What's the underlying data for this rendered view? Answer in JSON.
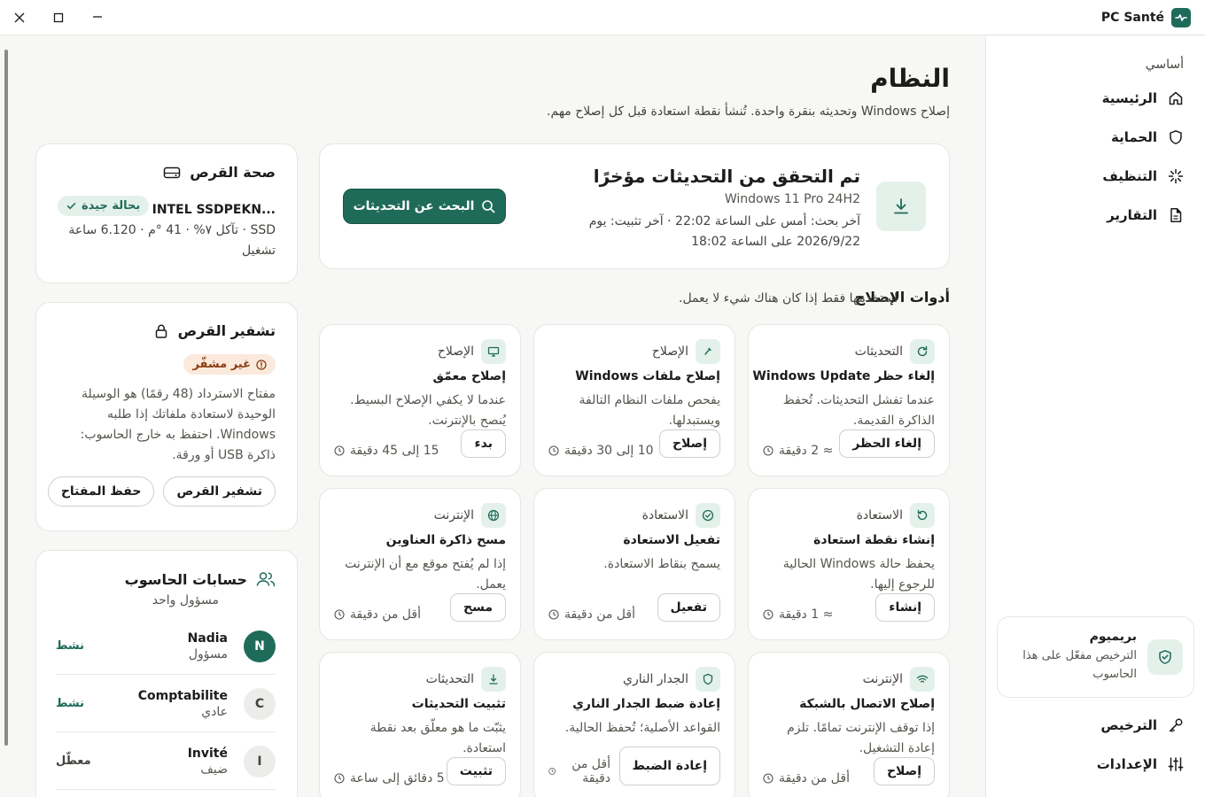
{
  "app": {
    "name": "PC Santé"
  },
  "sidebar": {
    "section_label": "أساسي",
    "items": [
      {
        "label": "الرئيسية",
        "icon": "home-icon"
      },
      {
        "label": "الحماية",
        "icon": "shield-icon"
      },
      {
        "label": "التنظيف",
        "icon": "sparkle-icon"
      },
      {
        "label": "التقارير",
        "icon": "document-icon"
      }
    ],
    "premium": {
      "title": "بريميوم",
      "text": "الترخيص مفعّل على هذا الحاسوب"
    },
    "bottom_items": [
      {
        "label": "الترخيص",
        "icon": "key-icon"
      },
      {
        "label": "الإعدادات",
        "icon": "sliders-icon"
      }
    ]
  },
  "page": {
    "title": "النظام",
    "subtitle": "إصلاح Windows وتحديثه بنقرة واحدة. تُنشأ نقطة استعادة قبل كل إصلاح مهم."
  },
  "update": {
    "title": "تم التحقق من التحديثات مؤخرًا",
    "os": "Windows 11 Pro 24H2",
    "meta": "آخر بحث: أمس على الساعة 22:02 · آخر تثبيت: يوم 2026/9/22 على الساعة 18:02",
    "button": "البحث عن التحديثات"
  },
  "tools": {
    "heading": "أدوات الإصلاح",
    "hint": "استخدمها فقط إذا كان هناك شيء لا يعمل.",
    "items": [
      {
        "category": "التحديثات",
        "title": "إلغاء حظر Windows Update",
        "desc": "عندما تفشل التحديثات. تُحفظ الذاكرة القديمة.",
        "time": "≈ 2 دقيقة",
        "button": "إلغاء الحظر"
      },
      {
        "category": "الإصلاح",
        "title": "إصلاح ملفات Windows",
        "desc": "يفحص ملفات النظام التالفة ويستبدلها.",
        "time": "10 إلى 30 دقيقة",
        "button": "إصلاح"
      },
      {
        "category": "الإصلاح",
        "title": "إصلاح معمّق",
        "desc": "عندما لا يكفي الإصلاح البسيط. يُنصح بالإنترنت.",
        "time": "15 إلى 45 دقيقة",
        "button": "بدء"
      },
      {
        "category": "الاستعادة",
        "title": "إنشاء نقطة استعادة",
        "desc": "يحفظ حالة Windows الحالية للرجوع إليها.",
        "time": "≈ 1 دقيقة",
        "button": "إنشاء"
      },
      {
        "category": "الاستعادة",
        "title": "تفعيل الاستعادة",
        "desc": "يسمح بنقاط الاستعادة.",
        "time": "أقل من دقيقة",
        "button": "تفعيل"
      },
      {
        "category": "الإنترنت",
        "title": "مسح ذاكرة العناوين",
        "desc": "إذا لم يُفتح موقع مع أن الإنترنت يعمل.",
        "time": "أقل من دقيقة",
        "button": "مسح"
      },
      {
        "category": "الإنترنت",
        "title": "إصلاح الاتصال بالشبكة",
        "desc": "إذا توقف الإنترنت تمامًا. تلزم إعادة التشغيل.",
        "time": "أقل من دقيقة",
        "button": "إصلاح"
      },
      {
        "category": "الجدار الناري",
        "title": "إعادة ضبط الجدار الناري",
        "desc": "القواعد الأصلية؛ تُحفظ الحالية.",
        "time": "أقل من دقيقة",
        "button": "إعادة الضبط"
      },
      {
        "category": "التحديثات",
        "title": "تثبيت التحديثات",
        "desc": "يثبّت ما هو معلّق بعد نقطة استعادة.",
        "time": "5 دقائق إلى ساعة",
        "button": "تثبيت"
      }
    ]
  },
  "disk": {
    "title": "صحة القرص",
    "model": "INTEL SSDPEKN...",
    "badge": "بحالة جيدة",
    "info": "SSD · تآكل ٧% · 41 °م · 6.120 ساعة تشغيل"
  },
  "encryption": {
    "title": "تشفير القرص",
    "badge": "غير مشفّر",
    "text": "مفتاح الاسترداد (48 رقمًا) هو الوسيلة الوحيدة لاستعادة ملفاتك إذا طلبه Windows. احتفظ به خارج الحاسوب: ذاكرة USB أو ورقة.",
    "encrypt_button": "تشفير القرص",
    "save_key_button": "حفظ المفتاح"
  },
  "accounts": {
    "title": "حسابات الحاسوب",
    "subtitle": "مسؤول واحد",
    "items": [
      {
        "initial": "N",
        "name": "Nadia",
        "role": "مسؤول",
        "status": "نشط",
        "active": true,
        "admin": true
      },
      {
        "initial": "C",
        "name": "Comptabilite",
        "role": "عادي",
        "status": "نشط",
        "active": true,
        "admin": false
      },
      {
        "initial": "I",
        "name": "Invité",
        "role": "ضيف",
        "status": "معطّل",
        "active": false,
        "admin": false
      }
    ]
  },
  "colors": {
    "accent": "#1f6b5a",
    "accent_soft": "#e4f1ea",
    "warn_soft": "#fbe9dc",
    "warn_text": "#8a3d10"
  }
}
